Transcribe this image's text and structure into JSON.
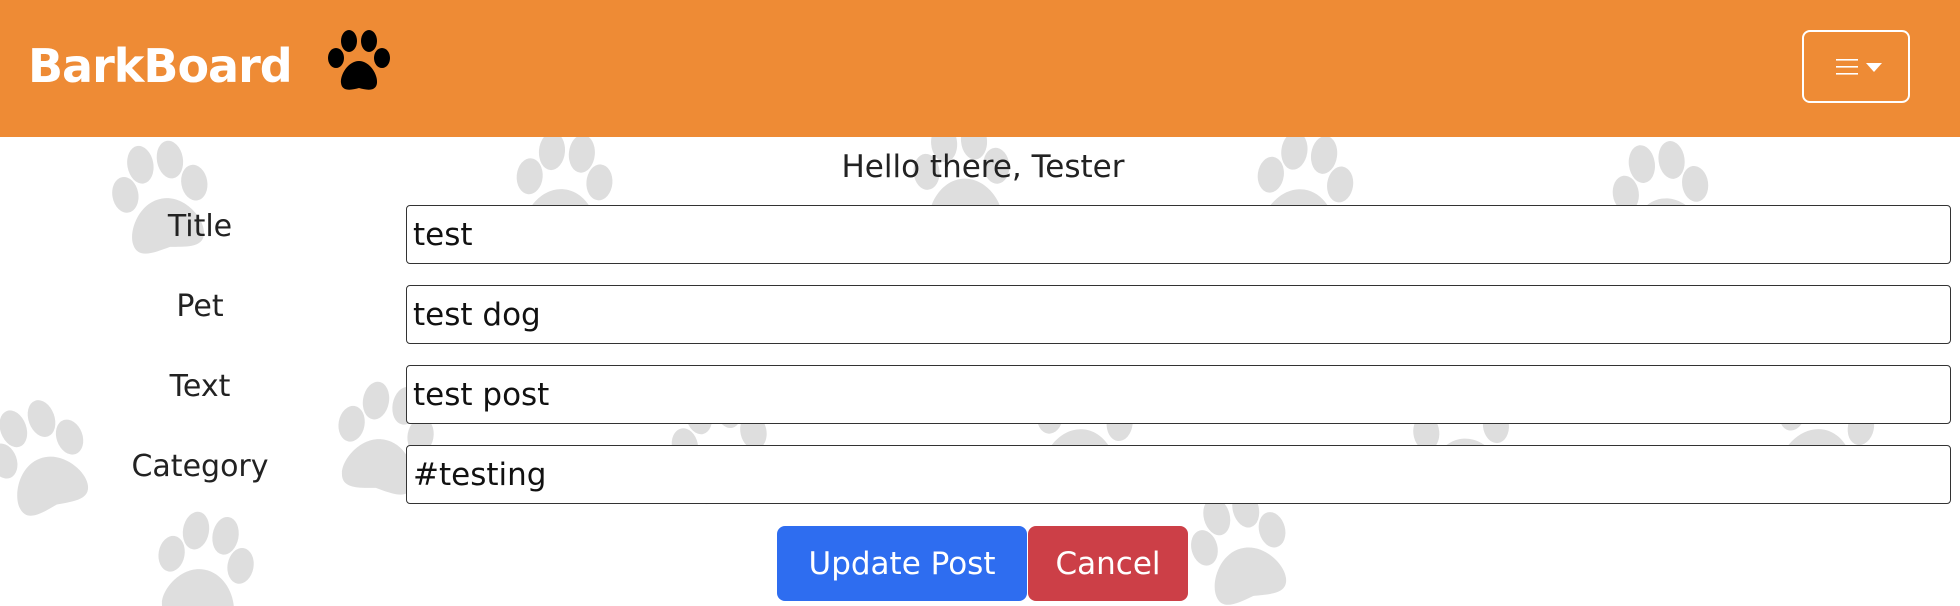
{
  "navbar": {
    "brand": "BarkBoard",
    "logo_icon": "paw-icon",
    "menu_icon": "hamburger-icon",
    "caret_icon": "caret-down-icon",
    "background_color": "#ee8b35"
  },
  "greeting": "Hello there, Tester",
  "form": {
    "fields": [
      {
        "label": "Title",
        "value": "test"
      },
      {
        "label": "Pet",
        "value": "test dog"
      },
      {
        "label": "Text",
        "value": "test post"
      },
      {
        "label": "Category",
        "value": "#testing"
      }
    ],
    "update_label": "Update Post",
    "cancel_label": "Cancel"
  },
  "colors": {
    "primary": "#2e6df0",
    "danger": "#cc3f47",
    "paw_watermark": "#dedede"
  }
}
